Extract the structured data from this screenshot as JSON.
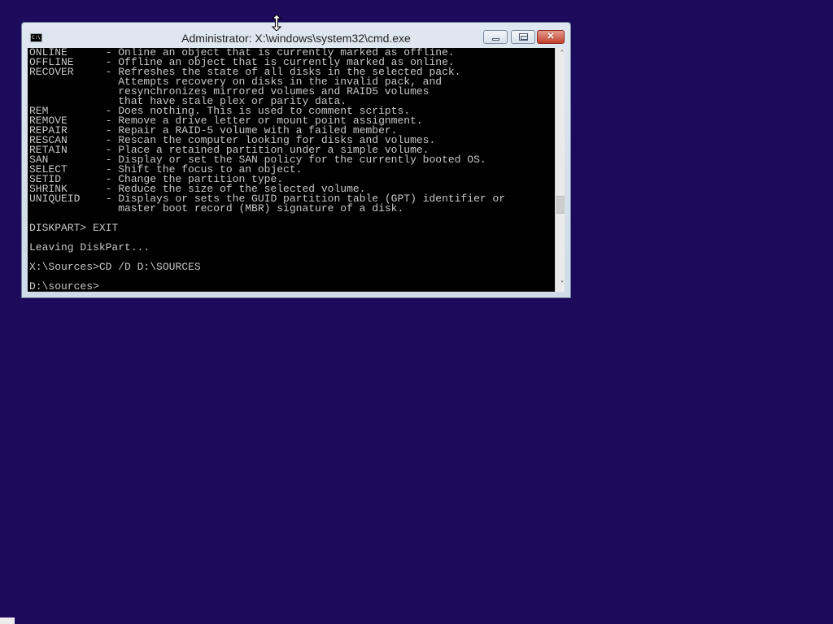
{
  "window": {
    "title": "Administrator: X:\\windows\\system32\\cmd.exe",
    "icon_label": "C:\\",
    "buttons": {
      "minimize": "minimize-icon",
      "maximize": "maximize-icon",
      "close": "×"
    }
  },
  "console": {
    "lines": [
      "ONLINE      - Online an object that is currently marked as offline.",
      "OFFLINE     - Offline an object that is currently marked as online.",
      "RECOVER     - Refreshes the state of all disks in the selected pack.",
      "              Attempts recovery on disks in the invalid pack, and",
      "              resynchronizes mirrored volumes and RAID5 volumes",
      "              that have stale plex or parity data.",
      "REM         - Does nothing. This is used to comment scripts.",
      "REMOVE      - Remove a drive letter or mount point assignment.",
      "REPAIR      - Repair a RAID-5 volume with a failed member.",
      "RESCAN      - Rescan the computer looking for disks and volumes.",
      "RETAIN      - Place a retained partition under a simple volume.",
      "SAN         - Display or set the SAN policy for the currently booted OS.",
      "SELECT      - Shift the focus to an object.",
      "SETID       - Change the partition type.",
      "SHRINK      - Reduce the size of the selected volume.",
      "UNIQUEID    - Displays or sets the GUID partition table (GPT) identifier or",
      "              master boot record (MBR) signature of a disk.",
      "",
      "DISKPART> EXIT",
      "",
      "Leaving DiskPart...",
      "",
      "X:\\Sources>CD /D D:\\SOURCES",
      "",
      "D:\\sources>"
    ]
  },
  "scrollbar": {
    "up_arrow": "˄",
    "down_arrow": "˅"
  },
  "colors": {
    "desktop_background": "#1d0a5a",
    "console_background": "#000000",
    "console_text": "#c8c8c8",
    "close_button": "#c4402d"
  },
  "cursor": "resize-vertical-cursor-icon"
}
